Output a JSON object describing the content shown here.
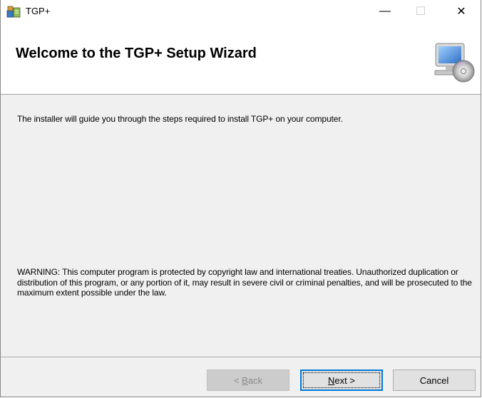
{
  "window": {
    "title": "TGP+",
    "minimize_glyph": "—",
    "maximize_glyph": "☐",
    "close_glyph": "✕"
  },
  "banner": {
    "title": "Welcome to the TGP+ Setup Wizard",
    "icon": "computer-with-cd-icon"
  },
  "content": {
    "intro": "The installer will guide you through the steps required to install TGP+ on your computer.",
    "warning": "WARNING: This computer program is protected by copyright law and international treaties. Unauthorized duplication or distribution of this program, or any portion of it, may result in severe civil or criminal penalties, and will be prosecuted to the maximum extent possible under the law."
  },
  "buttons": {
    "back_prefix": "< ",
    "back_accel": "B",
    "back_rest": "ack",
    "next_accel": "N",
    "next_rest": "ext >",
    "cancel": "Cancel"
  },
  "colors": {
    "focus": "#0078d7",
    "dialog_bg": "#f0f0f0"
  }
}
